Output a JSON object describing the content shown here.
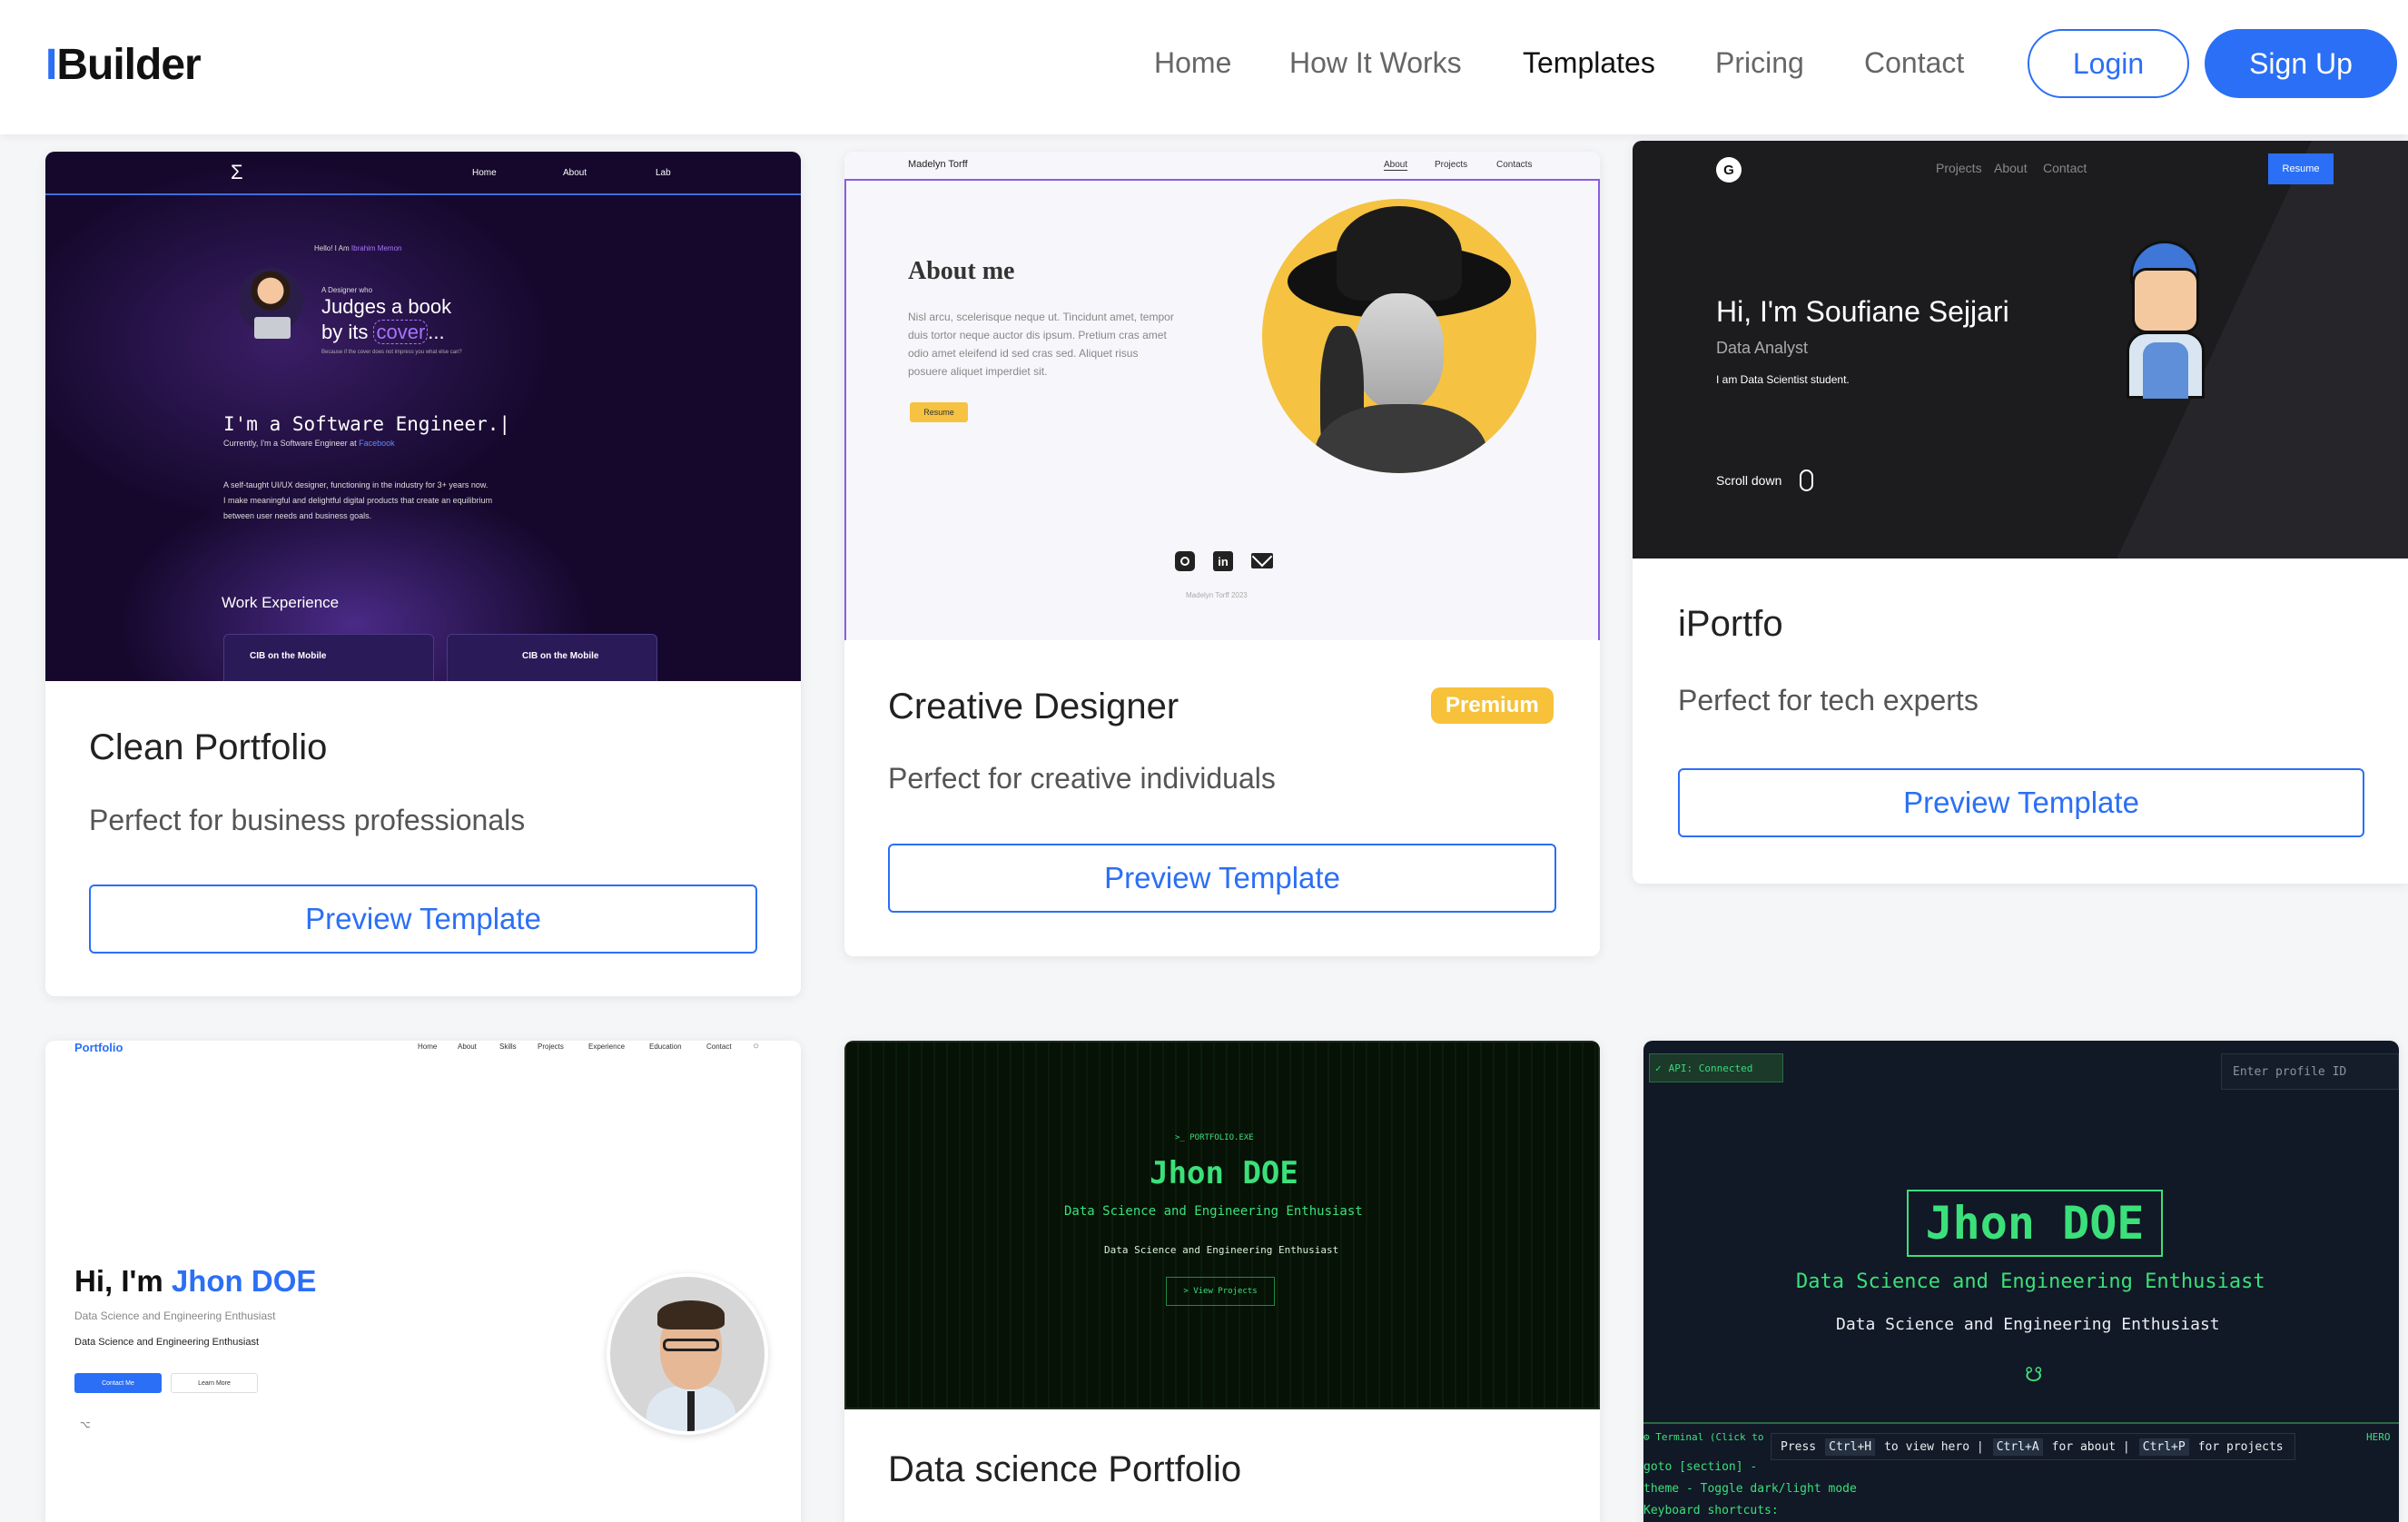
{
  "app": {
    "logo_bar": "I",
    "logo_text": "Builder"
  },
  "nav": {
    "links": [
      "Home",
      "How It Works",
      "Templates",
      "Pricing",
      "Contact"
    ],
    "active": "Templates",
    "login": "Login",
    "signup": "Sign Up"
  },
  "colors": {
    "accent": "#2b6ff6",
    "premium": "#f7c23a"
  },
  "cards": [
    {
      "title": "Clean Portfolio",
      "description": "Perfect for business professionals",
      "button": "Preview Template",
      "preview": {
        "logo": "Σ",
        "nav": [
          "Home",
          "About",
          "Lab"
        ],
        "hello_prefix": "Hello! I Am ",
        "hello_name": "Ibrahim Memon",
        "designer_line": "A Designer who",
        "headline_1": "Judges a book",
        "headline_2": "by its ",
        "headline_2_highlight": "cover",
        "headline_2_end": "...",
        "small_note": "Because if the cover does not impress you what else can?",
        "role": "I'm a Software Engineer.|",
        "current_prefix": "Currently, I'm a Software Engineer at ",
        "current_company": "Facebook",
        "about_1": "A self-taught UI/UX designer, functioning in the industry for 3+ years now.",
        "about_2": "I make meaningful and delightful digital products that create an equilibrium",
        "about_3": "between user needs and business goals.",
        "work_heading": "Work Experience",
        "work_1": "CIB on the Mobile",
        "work_2": "CIB on the Mobile"
      }
    },
    {
      "title": "Creative Designer",
      "badge": "Premium",
      "description": "Perfect for creative individuals",
      "button": "Preview Template",
      "preview": {
        "name": "Madelyn Torff",
        "nav": [
          "About",
          "Projects",
          "Contacts"
        ],
        "heading": "About me",
        "para_1": "Nisl arcu, scelerisque neque ut. Tincidunt amet, tempor",
        "para_2": "duis tortor neque auctor dis ipsum. Pretium cras amet",
        "para_3": "odio amet eleifend id sed cras sed. Aliquet risus",
        "para_4": "posuere aliquet imperdiet sit.",
        "resume": "Resume",
        "footer": "Madelyn Torff 2023"
      }
    },
    {
      "title": "iPortfo",
      "description": "Perfect for tech experts",
      "button": "Preview Template",
      "preview": {
        "nav": [
          "Projects",
          "About",
          "Contact"
        ],
        "resume": "Resume",
        "headline": "Hi, I'm Soufiane Sejjari",
        "role": "Data Analyst",
        "bio": "I am Data Scientist student.",
        "scroll": "Scroll down"
      }
    },
    {
      "preview": {
        "logo": "Portfolio",
        "nav": [
          "Home",
          "About",
          "Skills",
          "Projects",
          "Experience",
          "Education",
          "Contact"
        ],
        "greeting": "Hi, I'm ",
        "name": "Jhon DOE",
        "subtitle": "Data Science and Engineering Enthusiast",
        "line": "Data Science and Engineering Enthusiast",
        "contact_btn": "Contact Me",
        "learn_btn": "Learn More"
      }
    },
    {
      "title": "Data science Portfolio",
      "preview": {
        "prompt": ">_ PORTFOLIO.EXE",
        "name": "Jhon DOE",
        "subtitle": "Data Science and Engineering Enthusiast",
        "line": "Data Science and Engineering Enthusiast",
        "btn": "> View Projects"
      }
    },
    {
      "preview": {
        "api": "API: Connected",
        "input_placeholder": "Enter profile ID",
        "name": "Jhon DOE",
        "subtitle": "Data Science and Engineering Enthusiast",
        "line": "Data Science and Engineering Enthusiast",
        "terminal_label": "Terminal (Click to",
        "hero_tag": "HERO",
        "hint_press": "Press",
        "hint_k1": "Ctrl+H",
        "hint_t1": "to view hero |",
        "hint_k2": "Ctrl+A",
        "hint_t2": "for about |",
        "hint_k3": "Ctrl+P",
        "hint_t3": "for projects",
        "term_1": "goto [section] -",
        "term_2": "theme - Toggle dark/light mode",
        "term_3": "Keyboard shortcuts:"
      }
    }
  ]
}
